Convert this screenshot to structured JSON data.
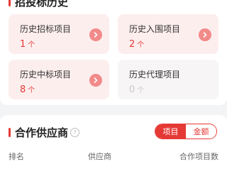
{
  "history": {
    "title": "招投标历史",
    "stats": [
      {
        "label": "历史招标项目",
        "count": "1",
        "unit": "个"
      },
      {
        "label": "历史入围项目",
        "count": "2",
        "unit": "个"
      },
      {
        "label": "历史中标项目",
        "count": "8",
        "unit": "个"
      },
      {
        "label": "历史代理项目",
        "count": "0",
        "unit": "个"
      }
    ]
  },
  "suppliers": {
    "title": "合作供应商",
    "help_icon": "?",
    "toggle": {
      "options": [
        "项目",
        "金额"
      ],
      "selected": "项目"
    },
    "columns": [
      "排名",
      "供应商",
      "合作项目数"
    ]
  },
  "colors": {
    "accent": "#e53935",
    "tile_bg": "#fdeeee",
    "arrow": "#f28a8a"
  }
}
